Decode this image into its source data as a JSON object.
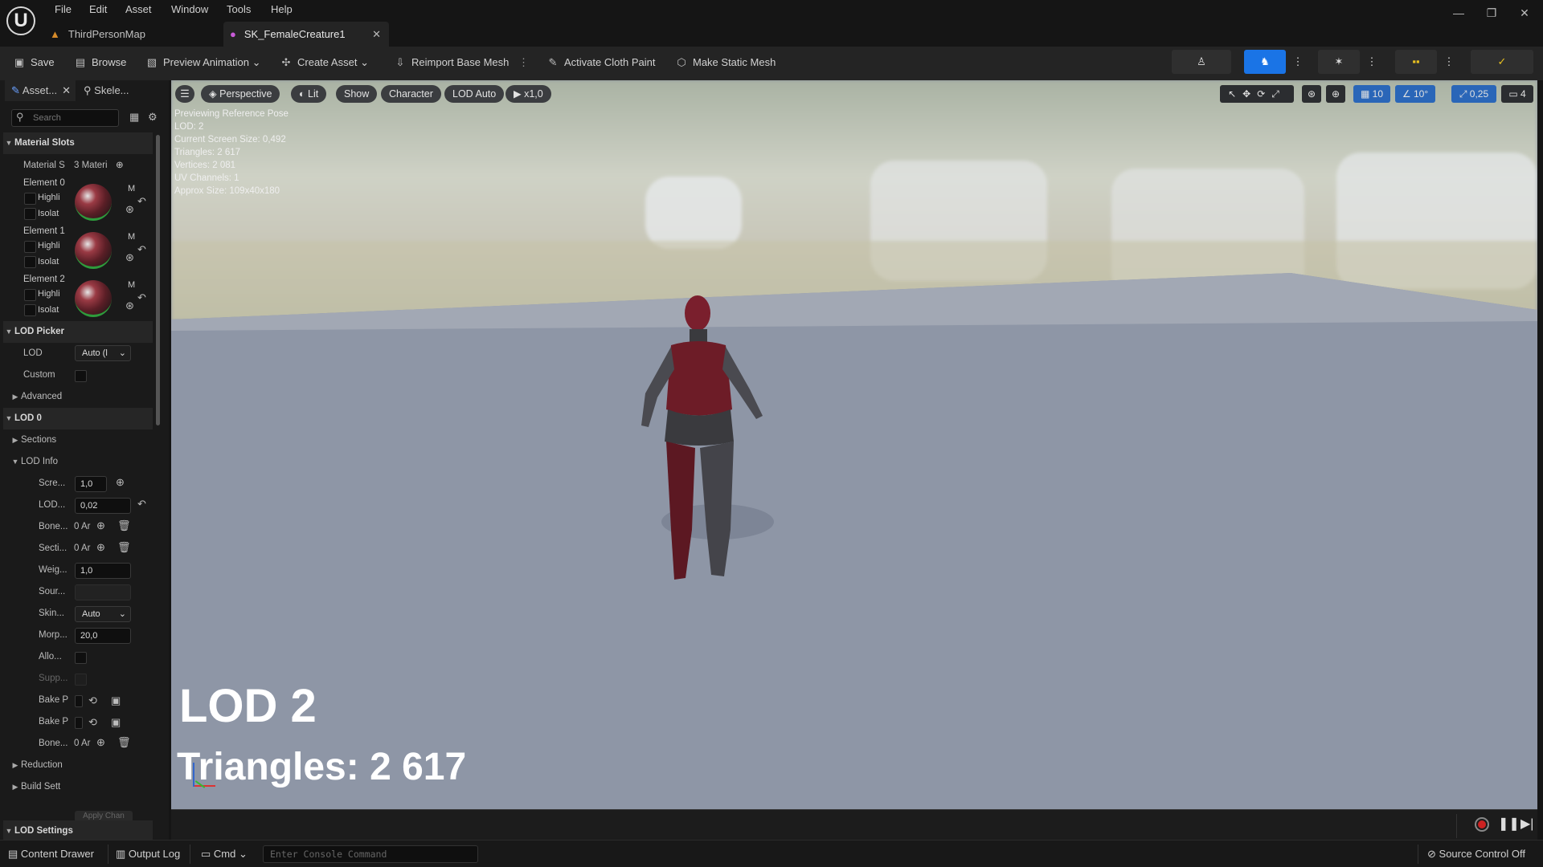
{
  "menu": [
    "File",
    "Edit",
    "Asset",
    "Window",
    "Tools",
    "Help"
  ],
  "tabs": [
    {
      "label": "ThirdPersonMap"
    },
    {
      "label": "SK_FemaleCreature1"
    }
  ],
  "toolbar": {
    "save": "Save",
    "browse": "Browse",
    "preview_animation": "Preview Animation",
    "create_asset": "Create Asset",
    "reimport": "Reimport Base Mesh",
    "cloth_paint": "Activate Cloth Paint",
    "static_mesh": "Make Static Mesh"
  },
  "left_tabs": [
    "Asset...",
    "Skele..."
  ],
  "search_placeholder": "Search",
  "details": {
    "material_slots": "Material Slots",
    "material_s": "Material S",
    "materials_count": "3 Materi",
    "elements": [
      "Element 0",
      "Element 1",
      "Element 2"
    ],
    "highlight": "Highli",
    "isolate": "Isolat",
    "m": "M",
    "lod_picker": "LOD Picker",
    "lod": "LOD",
    "lod_value": "Auto (l",
    "custom": "Custom",
    "advanced": "Advanced",
    "lod0": "LOD 0",
    "sections": "Sections",
    "lod_info": "LOD Info",
    "screen_label": "Scre...",
    "screen_value": "1,0",
    "lod_hys_label": "LOD...",
    "lod_hys_value": "0,02",
    "bone_label": "Bone...",
    "bone_value": "0 Ar",
    "section_label": "Secti...",
    "section_value": "0 Ar",
    "weight_label": "Weig...",
    "weight_value": "1,0",
    "source_label": "Sour...",
    "skin_label": "Skin...",
    "skin_value": "Auto",
    "morph_label": "Morp...",
    "morph_value": "20,0",
    "allow_label": "Allo...",
    "support_label": "Supp...",
    "bake_label": "Bake P",
    "bone2_label": "Bone...",
    "bone2_value": "0 Ar",
    "reduction": "Reduction",
    "build_settings": "Build Sett",
    "apply": "Apply Chan",
    "lod_settings": "LOD Settings"
  },
  "viewport": {
    "perspective": "Perspective",
    "lit": "Lit",
    "show": "Show",
    "character": "Character",
    "lod_auto": "LOD Auto",
    "speed": "x1,0",
    "grid_snap": "10",
    "angle_snap": "10°",
    "scale_snap": "0,25",
    "camera_speed": "4",
    "stats": [
      "Previewing Reference Pose",
      "LOD: 2",
      "Current Screen Size: 0,492",
      "Triangles: 2 617",
      "Vertices: 2 081",
      "UV Channels: 1",
      "Approx Size: 109x40x180"
    ],
    "big_lod": "LOD 2",
    "big_triangles": "Triangles: 2 617"
  },
  "statusbar": {
    "content_drawer": "Content Drawer",
    "output_log": "Output Log",
    "cmd": "Cmd",
    "console_placeholder": "Enter Console Command",
    "source_control": "Source Control Off"
  },
  "colors": {
    "accent_blue": "#1a74e6",
    "snap_blue": "#2a66b8",
    "valid_green": "#2e9b3c"
  }
}
